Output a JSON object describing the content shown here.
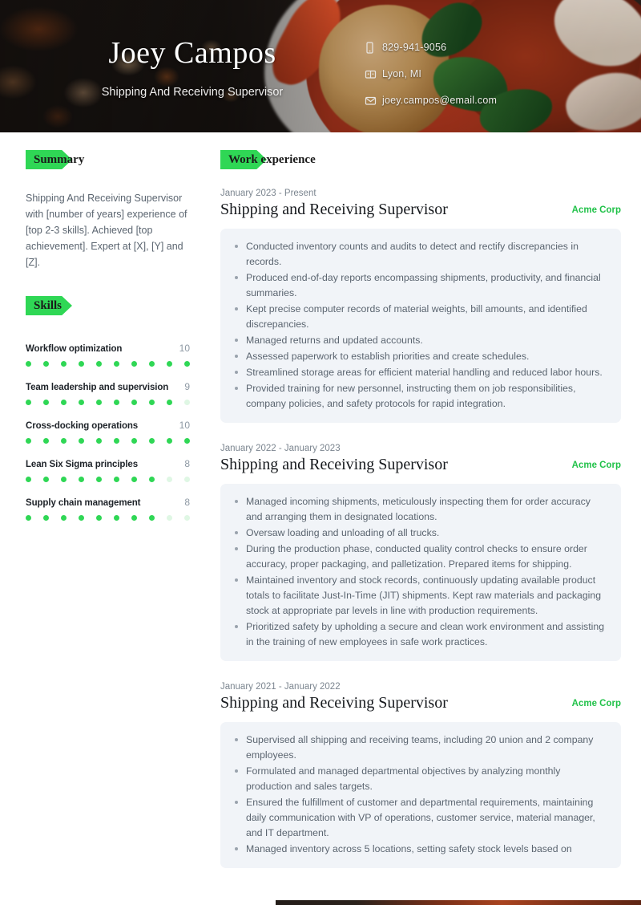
{
  "header": {
    "name": "Joey Campos",
    "job_title": "Shipping And Receiving Supervisor",
    "contact": [
      {
        "icon": "phone-icon",
        "text": "829-941-9056"
      },
      {
        "icon": "location-icon",
        "text": "Lyon, MI"
      },
      {
        "icon": "email-icon",
        "text": "joey.campos@email.com"
      }
    ]
  },
  "sidebar": {
    "summary_heading": "Summary",
    "summary_text": "Shipping And Receiving Supervisor with [number of years] experience of [top 2-3 skills]. Achieved [top achievement]. Expert at [X], [Y] and [Z].",
    "skills_heading": "Skills",
    "skills": [
      {
        "name": "Workflow optimization",
        "score": "10",
        "value": 10,
        "max": 10
      },
      {
        "name": "Team leadership and supervision",
        "score": "9",
        "value": 9,
        "max": 10
      },
      {
        "name": "Cross-docking operations",
        "score": "10",
        "value": 10,
        "max": 10
      },
      {
        "name": "Lean Six Sigma principles",
        "score": "8",
        "value": 8,
        "max": 10
      },
      {
        "name": "Supply chain management",
        "score": "8",
        "value": 8,
        "max": 10
      }
    ]
  },
  "main": {
    "experience_heading": "Work experience",
    "jobs": [
      {
        "dates": "January 2023 - Present",
        "role": "Shipping and Receiving Supervisor",
        "company": "Acme Corp",
        "bullets": [
          "Conducted inventory counts and audits to detect and rectify discrepancies in records.",
          "Produced end-of-day reports encompassing shipments, productivity, and financial summaries.",
          "Kept precise computer records of material weights, bill amounts, and identified discrepancies.",
          "Managed returns and updated accounts.",
          "Assessed paperwork to establish priorities and create schedules.",
          "Streamlined storage areas for efficient material handling and reduced labor hours.",
          "Provided training for new personnel, instructing them on job responsibilities, company policies, and safety protocols for rapid integration."
        ]
      },
      {
        "dates": "January 2022 - January 2023",
        "role": "Shipping and Receiving Supervisor",
        "company": "Acme Corp",
        "bullets": [
          "Managed incoming shipments, meticulously inspecting them for order accuracy and arranging them in designated locations.",
          "Oversaw loading and unloading of all trucks.",
          "During the production phase, conducted quality control checks to ensure order accuracy, proper packaging, and palletization. Prepared items for shipping.",
          "Maintained inventory and stock records, continuously updating available product totals to facilitate Just-In-Time (JIT) shipments. Kept raw materials and packaging stock at appropriate par levels in line with production requirements.",
          "Prioritized safety by upholding a secure and clean work environment and assisting in the training of new employees in safe work practices."
        ]
      },
      {
        "dates": "January 2021 - January 2022",
        "role": "Shipping and Receiving Supervisor",
        "company": "Acme Corp",
        "bullets": [
          "Supervised all shipping and receiving teams, including 20 union and 2 company employees.",
          "Formulated and managed departmental objectives by analyzing monthly production and sales targets.",
          "Ensured the fulfillment of customer and departmental requirements, maintaining daily communication with VP of operations, customer service, material manager, and IT department.",
          "Managed inventory across 5 locations, setting safety stock levels based on"
        ]
      }
    ]
  },
  "colors": {
    "accent_green": "#2fd755",
    "company_green": "#22c24a",
    "dot_off": "#dff7e4",
    "box_bg": "#f1f4f8",
    "body_text": "#5b6570"
  }
}
